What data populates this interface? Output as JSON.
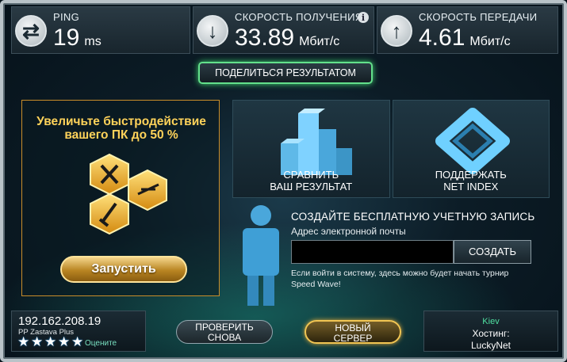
{
  "stats": {
    "ping": {
      "label": "PING",
      "value": "19",
      "unit": "ms"
    },
    "download": {
      "label": "СКОРОСТЬ ПОЛУЧЕНИЯ",
      "value": "33.89",
      "unit": "Мбит/с",
      "info": "i"
    },
    "upload": {
      "label": "СКОРОСТЬ ПЕРЕДАЧИ",
      "value": "4.61",
      "unit": "Мбит/с"
    }
  },
  "share_label": "ПОДЕЛИТЬСЯ РЕЗУЛЬТАТОМ",
  "promo": {
    "title": "Увеличьте быстродействие\nвашего ПК до 50 %",
    "launch_label": "Запустить",
    "colors": {
      "accent": "#ffd35a",
      "border": "#c98d2a"
    }
  },
  "tiles": [
    {
      "label": "СРАВНИТЬ\nВАШ РЕЗУЛЬТАТ",
      "icon": "bar-chart-icon"
    },
    {
      "label": "ПОДДЕРЖАТЬ\nNET INDEX",
      "icon": "net-index-icon"
    }
  ],
  "account": {
    "title": "СОЗДАЙТЕ БЕСПЛАТНУЮ УЧЕТНУЮ ЗАПИСЬ",
    "email_label": "Адрес электронной почты",
    "email_value": "",
    "create_label": "СОЗДАТЬ",
    "note": "Если войти в систему, здесь можно будет начать турнир Speed Wave!"
  },
  "server": {
    "ip": "192.162.208.19",
    "isp": "PP Zastava Plus",
    "stars": 5,
    "rate_label": "Оцените"
  },
  "buttons": {
    "retest": "ПРОВЕРИТЬ\nСНОВА",
    "new_server": "НОВЫЙ\nСЕРВЕР"
  },
  "host": {
    "city": "Kiev",
    "label": "Хостинг:",
    "name": "LuckyNet"
  },
  "colors": {
    "share_border": "#63e08b",
    "city": "#4fe0a0"
  }
}
